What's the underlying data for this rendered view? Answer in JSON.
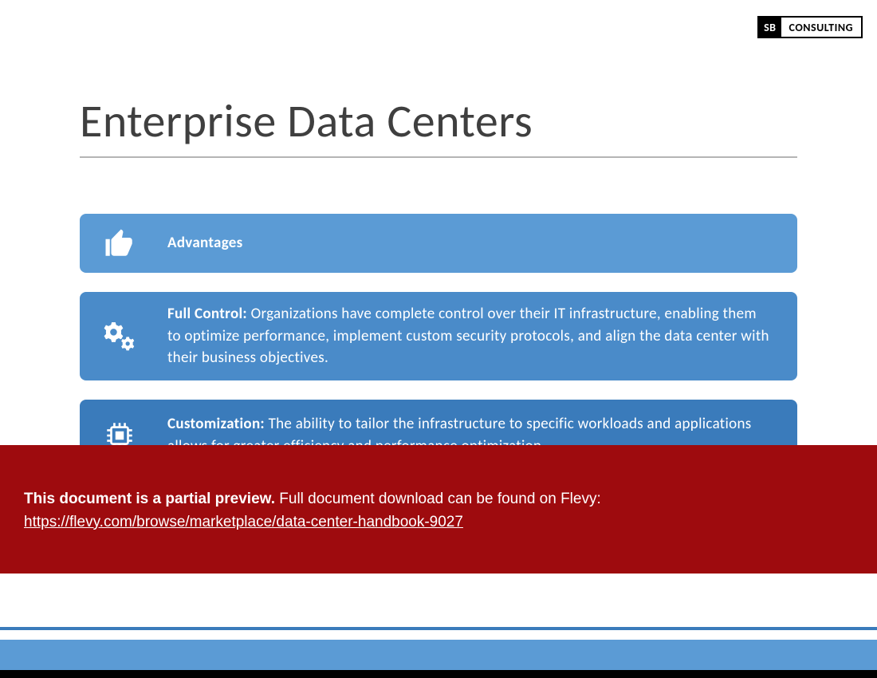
{
  "logo": {
    "sb": "SB",
    "consulting": "CONSULTING"
  },
  "title": "Enterprise Data Centers",
  "cards": {
    "header": {
      "label": "Advantages"
    },
    "item1": {
      "bold": "Full Control:",
      "rest": " Organizations have complete control over their IT infrastructure, enabling them to optimize performance, implement custom security protocols, and align the data center with their business objectives."
    },
    "item2": {
      "bold": "Customization:",
      "rest": " The ability to tailor the infrastructure to specific workloads and applications allows for greater efficiency and performance optimization."
    }
  },
  "preview": {
    "bold": "This document is a partial preview.",
    "rest": "  Full document download can be found on Flevy:",
    "link_text": "https://flevy.com/browse/marketplace/data-center-handbook-9027",
    "link_href": "https://flevy.com/browse/marketplace/data-center-handbook-9027"
  }
}
